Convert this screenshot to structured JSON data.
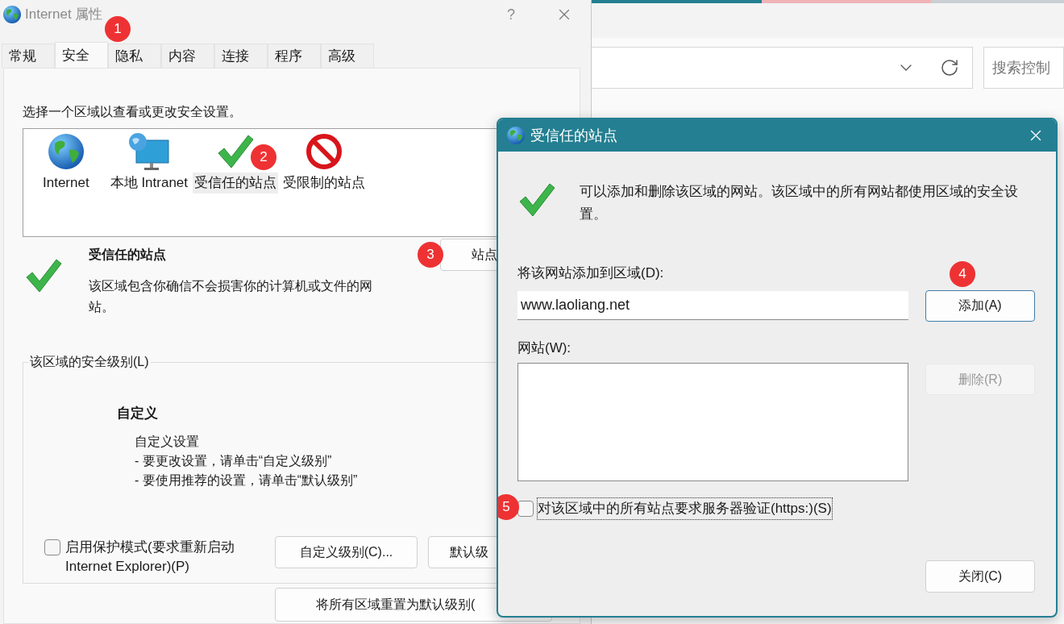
{
  "background_window": {
    "search_placeholder": "搜索控制"
  },
  "dialog": {
    "title": "Internet 属性",
    "help": "?",
    "tabs": [
      {
        "label": "常规",
        "selected": false
      },
      {
        "label": "安全",
        "selected": true,
        "badge": "1"
      },
      {
        "label": "隐私",
        "selected": false
      },
      {
        "label": "内容",
        "selected": false
      },
      {
        "label": "连接",
        "selected": false
      },
      {
        "label": "程序",
        "selected": false
      },
      {
        "label": "高级",
        "selected": false
      }
    ],
    "instruction": "选择一个区域以查看或更改安全设置。",
    "zones": [
      {
        "label": "Internet",
        "kind": "internet",
        "selected": false
      },
      {
        "label": "本地 Intranet",
        "kind": "intranet",
        "selected": false
      },
      {
        "label": "受信任的站点",
        "kind": "trusted",
        "selected": true,
        "badge": "2"
      },
      {
        "label": "受限制的站点",
        "kind": "restricted",
        "selected": false
      }
    ],
    "zone_info": {
      "kind": "trusted",
      "title": "受信任的站点",
      "description": "该区域包含你确信不会损害你的计算机或文件的网站。"
    },
    "sites_button": {
      "label": "站点",
      "badge": "3"
    },
    "security_level": {
      "legend": "该区域的安全级别(L)",
      "level_name": "自定义",
      "lines": [
        "自定义设置",
        "- 要更改设置，请单击“自定义级别”",
        "- 要使用推荐的设置，请单击“默认级别”"
      ]
    },
    "protected_mode": {
      "label": "启用保护模式(要求重新启动 Internet Explorer)(P)",
      "checked": false
    },
    "buttons": [
      {
        "label": "自定义级别(C)..."
      },
      {
        "label": "默认级"
      }
    ],
    "reset_button": "将所有区域重置为默认级别("
  },
  "trusted_dialog": {
    "title": "受信任的站点",
    "message": "可以添加和删除该区域的网站。该区域中的所有网站都使用区域的安全设置。",
    "add_label": "将该网站添加到区域(D):",
    "url_value": "www.laoliang.net",
    "add_button": {
      "label": "添加(A)",
      "badge": "4",
      "disabled": false
    },
    "list_label": "网站(W):",
    "remove_button": {
      "label": "删除(R)",
      "disabled": true
    },
    "https_check": {
      "label": "对该区域中的所有站点要求服务器验证(https:)(S)",
      "checked": false,
      "badge": "5"
    },
    "close_button": "关闭(C)"
  }
}
